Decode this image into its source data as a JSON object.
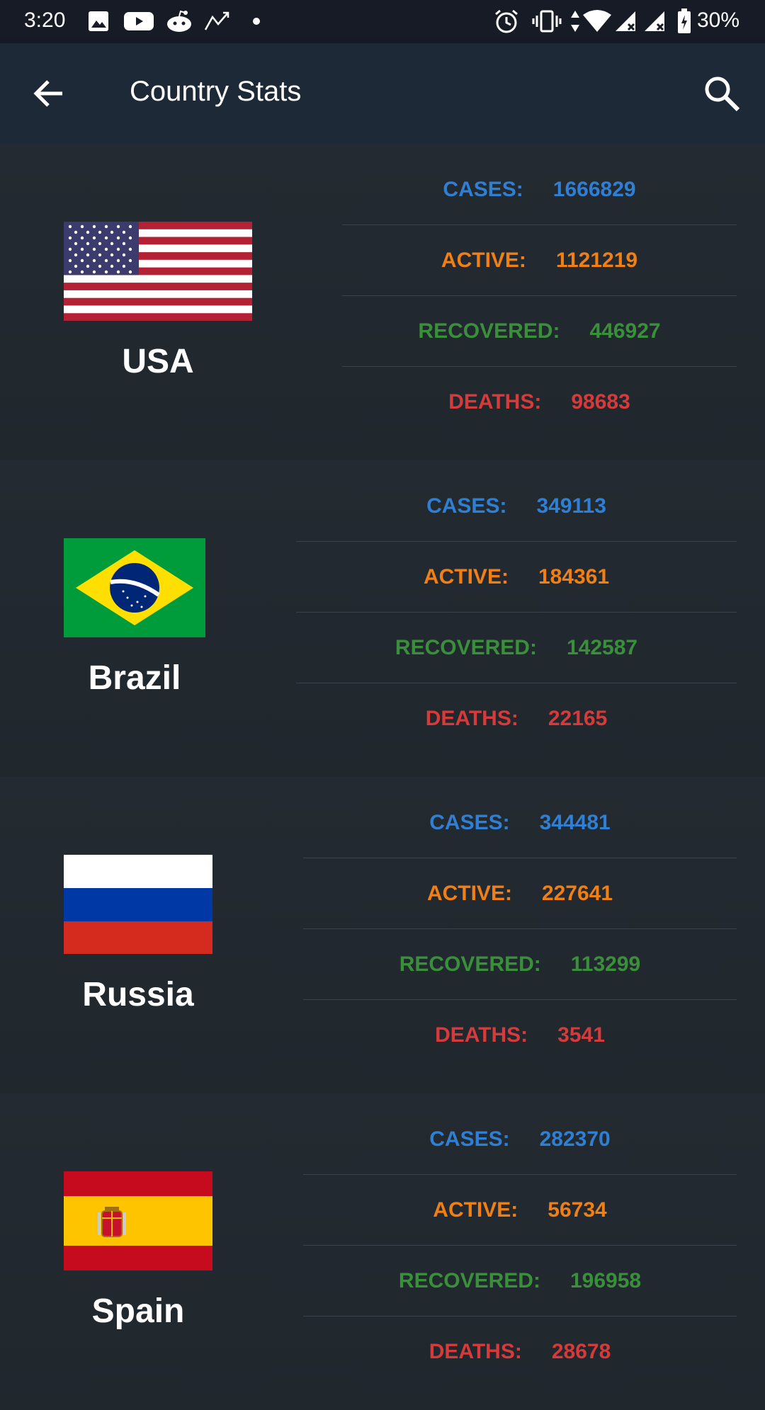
{
  "status_bar": {
    "time": "3:20",
    "battery": "30%"
  },
  "app_bar": {
    "title": "Country Stats"
  },
  "labels": {
    "cases": "CASES:",
    "active": "ACTIVE:",
    "recovered": "RECOVERED:",
    "deaths": "DEATHS:"
  },
  "countries": [
    {
      "name": "USA",
      "cases": "1666829",
      "active": "1121219",
      "recovered": "446927",
      "deaths": "98683"
    },
    {
      "name": "Brazil",
      "cases": "349113",
      "active": "184361",
      "recovered": "142587",
      "deaths": "22165"
    },
    {
      "name": "Russia",
      "cases": "344481",
      "active": "227641",
      "recovered": "113299",
      "deaths": "3541"
    },
    {
      "name": "Spain",
      "cases": "282370",
      "active": "56734",
      "recovered": "196958",
      "deaths": "28678"
    }
  ],
  "colors": {
    "cases": "#2f7fd4",
    "active": "#f07f14",
    "recovered": "#3a8f3a",
    "deaths": "#d63a3a"
  }
}
